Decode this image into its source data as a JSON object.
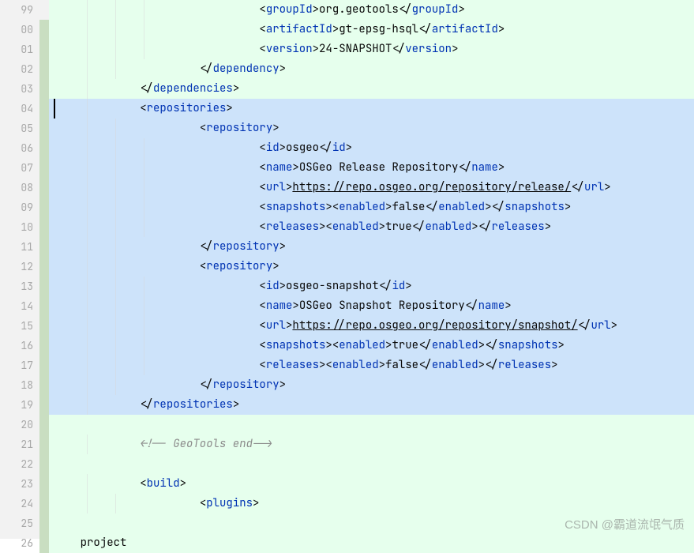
{
  "line_numbers": [
    "99",
    "00",
    "01",
    "02",
    "03",
    "04",
    "05",
    "06",
    "07",
    "08",
    "09",
    "10",
    "11",
    "12",
    "13",
    "14",
    "15",
    "16",
    "17",
    "18",
    "19",
    "20",
    "21",
    "22",
    "23",
    "24",
    "25",
    "26"
  ],
  "lines": {
    "vcs_added_indices": [
      1,
      2,
      3,
      4,
      5,
      6,
      7,
      8,
      9,
      10,
      11,
      12,
      13,
      14,
      15,
      16,
      17,
      18,
      19,
      20,
      21,
      22,
      23,
      24,
      25,
      26,
      27
    ],
    "bg_map": {
      "green": [
        0,
        1,
        2,
        3,
        4,
        21,
        22,
        23,
        24,
        25,
        26,
        27
      ],
      "blue": [
        5,
        6,
        7,
        8,
        9,
        10,
        11,
        12,
        13,
        14,
        15,
        16,
        17,
        18,
        19,
        20
      ],
      "white": []
    }
  },
  "code": {
    "l0": {
      "indent": 5,
      "open": [
        "groupId"
      ],
      "text": "org.geotools",
      "close": [
        "groupId"
      ]
    },
    "l1": {
      "indent": 5,
      "open": [
        "artifactId"
      ],
      "text": "gt-epsg-hsql",
      "close": [
        "artifactId"
      ]
    },
    "l2": {
      "indent": 5,
      "open": [
        "version"
      ],
      "text": "24-SNAPSHOT",
      "close": [
        "version"
      ]
    },
    "l3": {
      "indent": 4,
      "close_tag": "dependency"
    },
    "l4": {
      "indent": 3,
      "close_tag": "dependencies"
    },
    "l5": {
      "indent": 3,
      "open_tag": "repositories",
      "caret": true
    },
    "l6": {
      "indent": 4,
      "open_tag": "repository"
    },
    "l7": {
      "indent": 5,
      "open": [
        "id"
      ],
      "text": "osgeo",
      "close": [
        "id"
      ]
    },
    "l8": {
      "indent": 5,
      "open": [
        "name"
      ],
      "text": "OSGeo Release Repository",
      "close": [
        "name"
      ]
    },
    "l9": {
      "indent": 5,
      "open": [
        "url"
      ],
      "url": "https://repo.osgeo.org/repository/release/",
      "close": [
        "url"
      ]
    },
    "l10": {
      "indent": 5,
      "open": [
        "snapshots",
        "enabled"
      ],
      "text": "false",
      "close": [
        "enabled",
        "snapshots"
      ]
    },
    "l11": {
      "indent": 5,
      "open": [
        "releases",
        "enabled"
      ],
      "text": "true",
      "close": [
        "enabled",
        "releases"
      ]
    },
    "l12": {
      "indent": 4,
      "close_tag": "repository"
    },
    "l13": {
      "indent": 4,
      "open_tag": "repository"
    },
    "l14": {
      "indent": 5,
      "open": [
        "id"
      ],
      "text": "osgeo-snapshot",
      "close": [
        "id"
      ]
    },
    "l15": {
      "indent": 5,
      "open": [
        "name"
      ],
      "text": "OSGeo Snapshot Repository",
      "close": [
        "name"
      ]
    },
    "l16": {
      "indent": 5,
      "open": [
        "url"
      ],
      "url": "https://repo.osgeo.org/repository/snapshot/",
      "close": [
        "url"
      ]
    },
    "l17": {
      "indent": 5,
      "open": [
        "snapshots",
        "enabled"
      ],
      "text": "true",
      "close": [
        "enabled",
        "snapshots"
      ]
    },
    "l18": {
      "indent": 5,
      "open": [
        "releases",
        "enabled"
      ],
      "text": "false",
      "close": [
        "enabled",
        "releases"
      ]
    },
    "l19": {
      "indent": 4,
      "close_tag": "repository"
    },
    "l20": {
      "indent": 3,
      "close_tag": "repositories"
    },
    "l21": {
      "blank": true
    },
    "l22": {
      "indent": 3,
      "comment": "<!-- GeoTools end-->"
    },
    "l23": {
      "blank": true
    },
    "l24": {
      "indent": 3,
      "open_tag": "build"
    },
    "l25": {
      "indent": 4,
      "open_tag": "plugins"
    },
    "l26": {
      "blank": true
    },
    "l27": {
      "indent": 2,
      "partial": "project"
    }
  },
  "watermark": "CSDN @霸道流氓气质"
}
